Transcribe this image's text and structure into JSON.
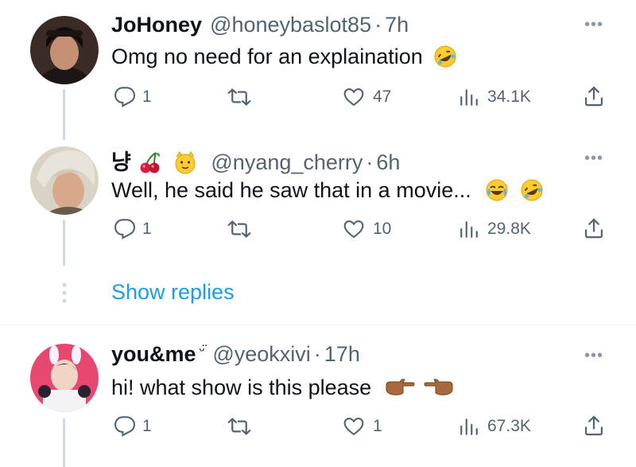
{
  "colors": {
    "accent": "#1d9bf0",
    "text": "#0f1419",
    "muted": "#536471",
    "line": "#cfd9de"
  },
  "tweets": [
    {
      "name": "JoHoney",
      "handle": "@honeybaslot85",
      "time": "7h",
      "text": "Omg no need for an explaination",
      "emojis": [
        "rofl-emoji"
      ],
      "replies": "1",
      "retweets": "",
      "likes": "47",
      "views": "34.1K"
    },
    {
      "name": "냥",
      "name_emojis": [
        "cherry-emoji",
        "cat-emoji"
      ],
      "handle": "@nyang_cherry",
      "time": "6h",
      "text": "Well, he said he saw that in a movie...",
      "emojis": [
        "tears-of-joy-emoji",
        "rofl-emoji"
      ],
      "replies": "1",
      "retweets": "",
      "likes": "10",
      "views": "29.8K"
    },
    {
      "name": "you&me",
      "name_suffix": "ᵕ̈",
      "handle": "@yeokxivi",
      "time": "17h",
      "text": "hi! what show is this please",
      "emojis": [
        "point-right-emoji",
        "point-left-emoji"
      ],
      "replies": "1",
      "retweets": "",
      "likes": "1",
      "views": "67.3K"
    }
  ],
  "show_replies": "Show replies",
  "separator_dot": "·"
}
